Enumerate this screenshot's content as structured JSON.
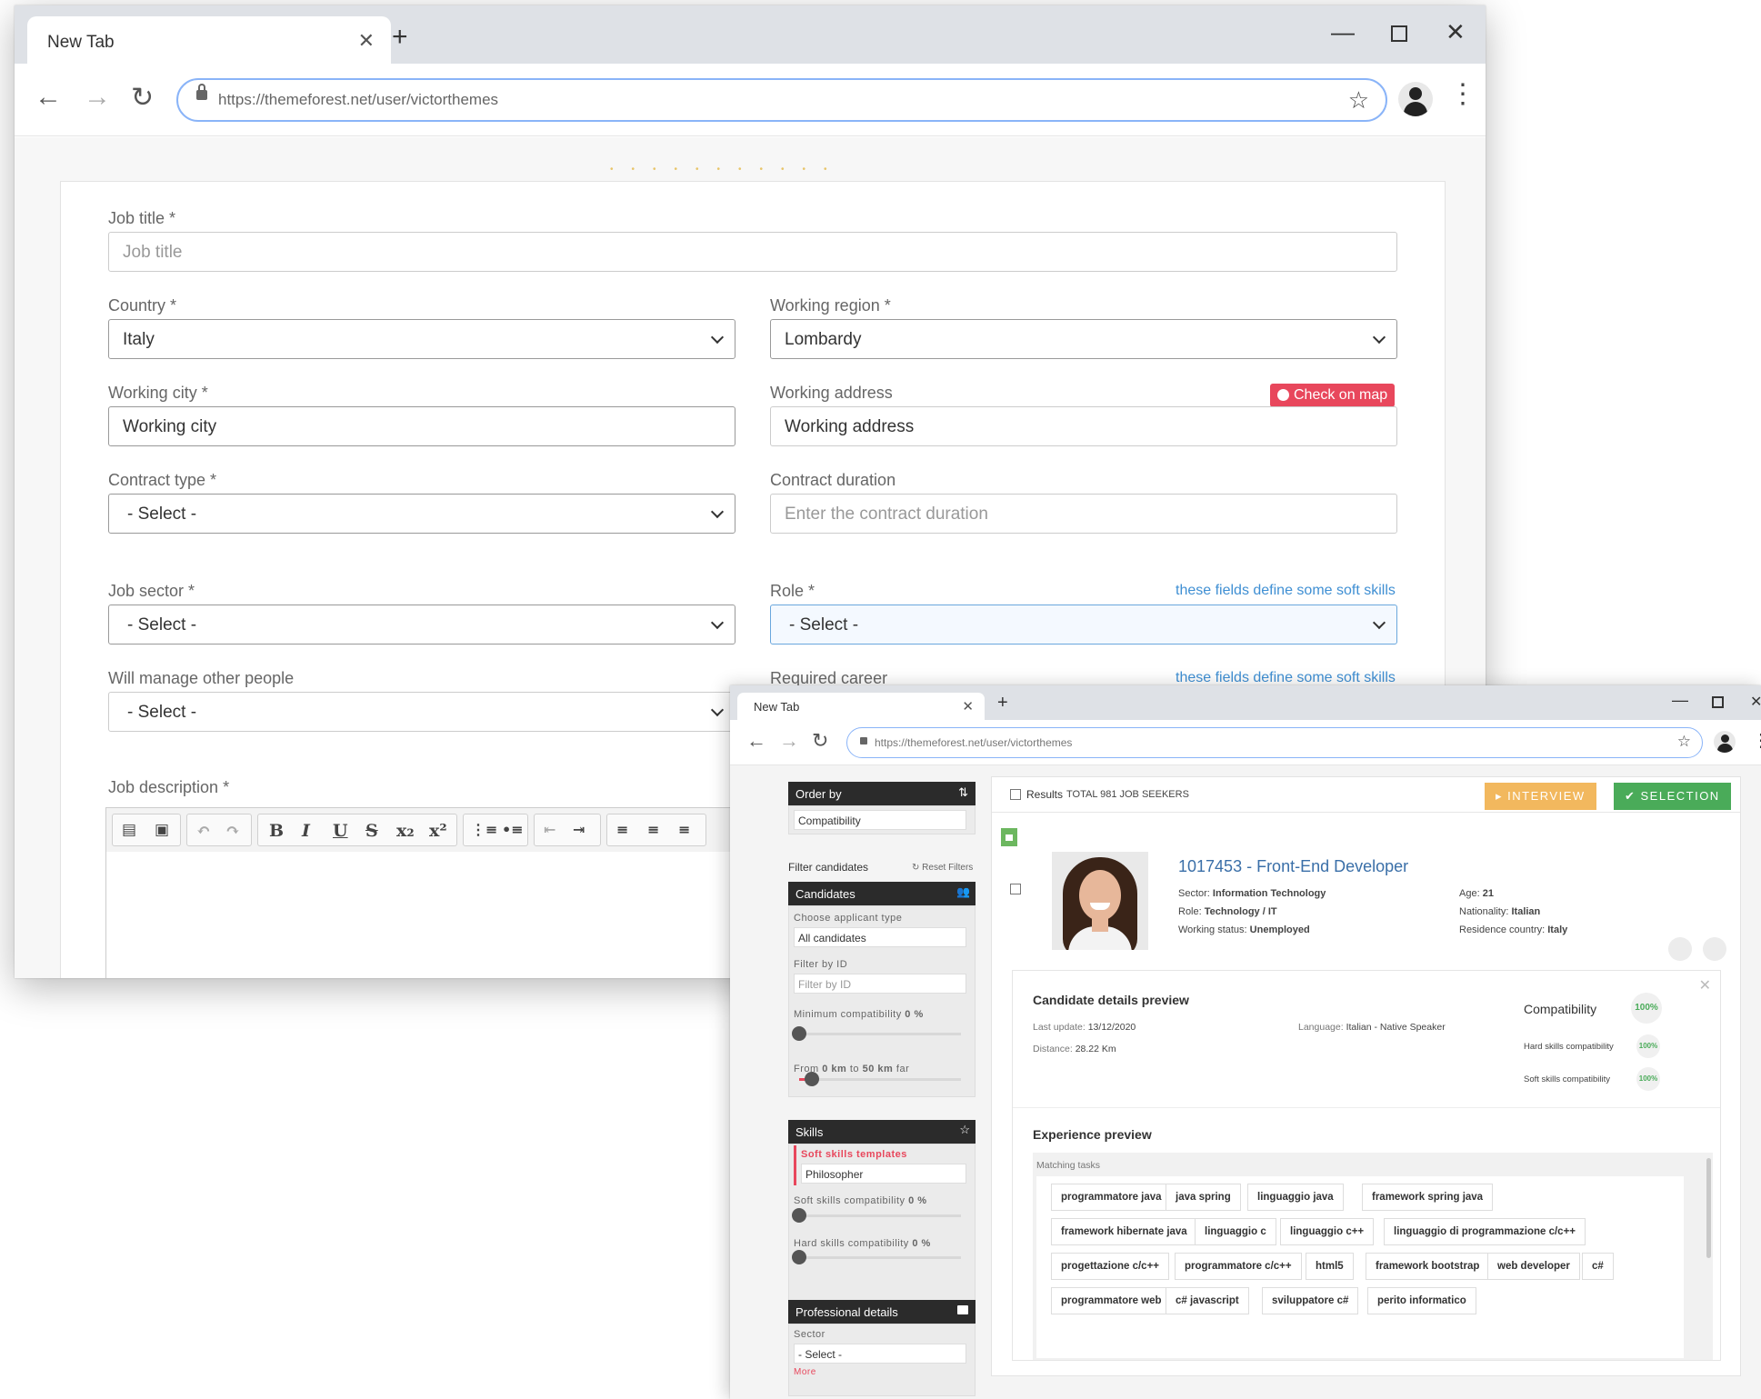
{
  "browser1": {
    "tab_title": "New Tab",
    "url": "https://themeforest.net/user/victorthemes"
  },
  "form": {
    "job_title_label": "Job title *",
    "job_title_placeholder": "Job title",
    "country_label": "Country *",
    "country_value": "Italy",
    "region_label": "Working region *",
    "region_value": "Lombardy",
    "city_label": "Working city *",
    "city_value": "Working city",
    "address_label": "Working address",
    "address_value": "Working address",
    "check_on_map": "Check on map",
    "contract_type_label": "Contract type *",
    "contract_type_value": "- Select -",
    "contract_duration_label": "Contract duration",
    "contract_duration_placeholder": "Enter the contract duration",
    "job_sector_label": "Job sector *",
    "job_sector_value": "- Select -",
    "role_label": "Role *",
    "role_value": "- Select -",
    "soft_skills_hint": "these fields define some soft skills",
    "manage_people_label": "Will manage other people",
    "manage_people_value": "- Select -",
    "required_career_label": "Required career",
    "job_description_label": "Job description *"
  },
  "browser2": {
    "tab_title": "New Tab",
    "url": "https://themeforest.net/user/victorthemes"
  },
  "sidebar": {
    "order_by": "Order by",
    "order_value": "Compatibility",
    "filter_candidates": "Filter candidates",
    "reset_filters": "Reset Filters",
    "candidates_header": "Candidates",
    "applicant_type_label": "Choose applicant type",
    "applicant_type_value": "All candidates",
    "filter_id_label": "Filter by ID",
    "filter_id_placeholder": "Filter by ID",
    "min_compat_label": "Minimum compatibility",
    "min_compat_value": "0 %",
    "min_compat_level": 0,
    "distance_from": "From",
    "distance_from_value": "0 km",
    "distance_to": "to",
    "distance_to_value": "50 km",
    "distance_suffix": "far",
    "distance_level": 0.08,
    "skills_header": "Skills",
    "soft_templates_label": "Soft skills templates",
    "soft_templates_value": "Philosopher",
    "soft_compat_label": "Soft skills compatibility",
    "soft_compat_value": "0 %",
    "soft_compat_level": 0,
    "hard_compat_label": "Hard skills compatibility",
    "hard_compat_value": "0 %",
    "hard_compat_level": 0,
    "professional_header": "Professional details",
    "sector_label": "Sector",
    "sector_value": "- Select -",
    "more": "More"
  },
  "results": {
    "results_label": "Results",
    "total_text": "TOTAL 981 JOB SEEKERS",
    "interview_btn": "INTERVIEW",
    "selection_btn": "SELECTION"
  },
  "candidate": {
    "title": "1017453 - Front-End Developer",
    "sector_label": "Sector:",
    "sector_value": "Information Technology",
    "role_label": "Role:",
    "role_value": "Technology / IT",
    "status_label": "Working status:",
    "status_value": "Unemployed",
    "age_label": "Age:",
    "age_value": "21",
    "nationality_label": "Nationality:",
    "nationality_value": "Italian",
    "residence_label": "Residence country:",
    "residence_value": "Italy"
  },
  "preview": {
    "title": "Candidate details preview",
    "last_update_label": "Last update:",
    "last_update_value": "13/12/2020",
    "distance_label": "Distance:",
    "distance_value": "28.22 Km",
    "language_label": "Language:",
    "language_value": "Italian - Native Speaker",
    "compatibility_label": "Compatibility",
    "compatibility_value": "100%",
    "hard_label": "Hard skills compatibility",
    "hard_value": "100%",
    "soft_label": "Soft skills compatibility",
    "soft_value": "100%",
    "experience_title": "Experience preview",
    "matching_tasks": "Matching tasks"
  },
  "tags": [
    "programmatore java",
    "java spring",
    "linguaggio java",
    "framework spring java",
    "framework hibernate java",
    "linguaggio c",
    "linguaggio c++",
    "linguaggio di programmazione c/c++",
    "progettazione c/c++",
    "programmatore c/c++",
    "html5",
    "framework bootstrap",
    "web developer",
    "c#",
    "programmatore web",
    "c# javascript",
    "sviluppatore c#",
    "perito informatico"
  ],
  "colors": {
    "accent_blue": "#3f8fd3",
    "map_button": "#e8475c",
    "interview": "#f2b85e",
    "selection": "#4aab59",
    "candidate_title": "#3a6fa8",
    "dark_header": "#2b2b2b"
  }
}
